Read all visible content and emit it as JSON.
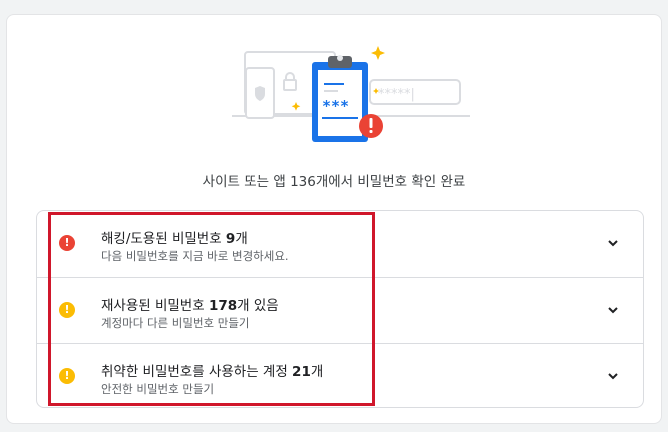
{
  "colors": {
    "danger": "#ea4335",
    "warning": "#fbbc04",
    "primary": "#1a73e8",
    "highlight_box": "#d0172b"
  },
  "illustration": {
    "icon": "password-check-illustration",
    "masked_password": "***",
    "dotted_field": "*****|"
  },
  "summary": "사이트 또는 앱 136개에서 비밀번호 확인 완료",
  "items": [
    {
      "icon": "error-icon",
      "color": "#ea4335",
      "title_prefix": "해킹/도용된 비밀번호 ",
      "title_count": "9",
      "title_suffix": "개",
      "subtitle": "다음 비밀번호를 지금 바로 변경하세요."
    },
    {
      "icon": "warning-icon",
      "color": "#fbbc04",
      "title_prefix": "재사용된 비밀번호 ",
      "title_count": "178",
      "title_suffix": "개 있음",
      "subtitle": "계정마다 다른 비밀번호 만들기"
    },
    {
      "icon": "warning-icon",
      "color": "#fbbc04",
      "title_prefix": "취약한 비밀번호를 사용하는 계정 ",
      "title_count": "21",
      "title_suffix": "개",
      "subtitle": "안전한 비밀번호 만들기"
    }
  ]
}
